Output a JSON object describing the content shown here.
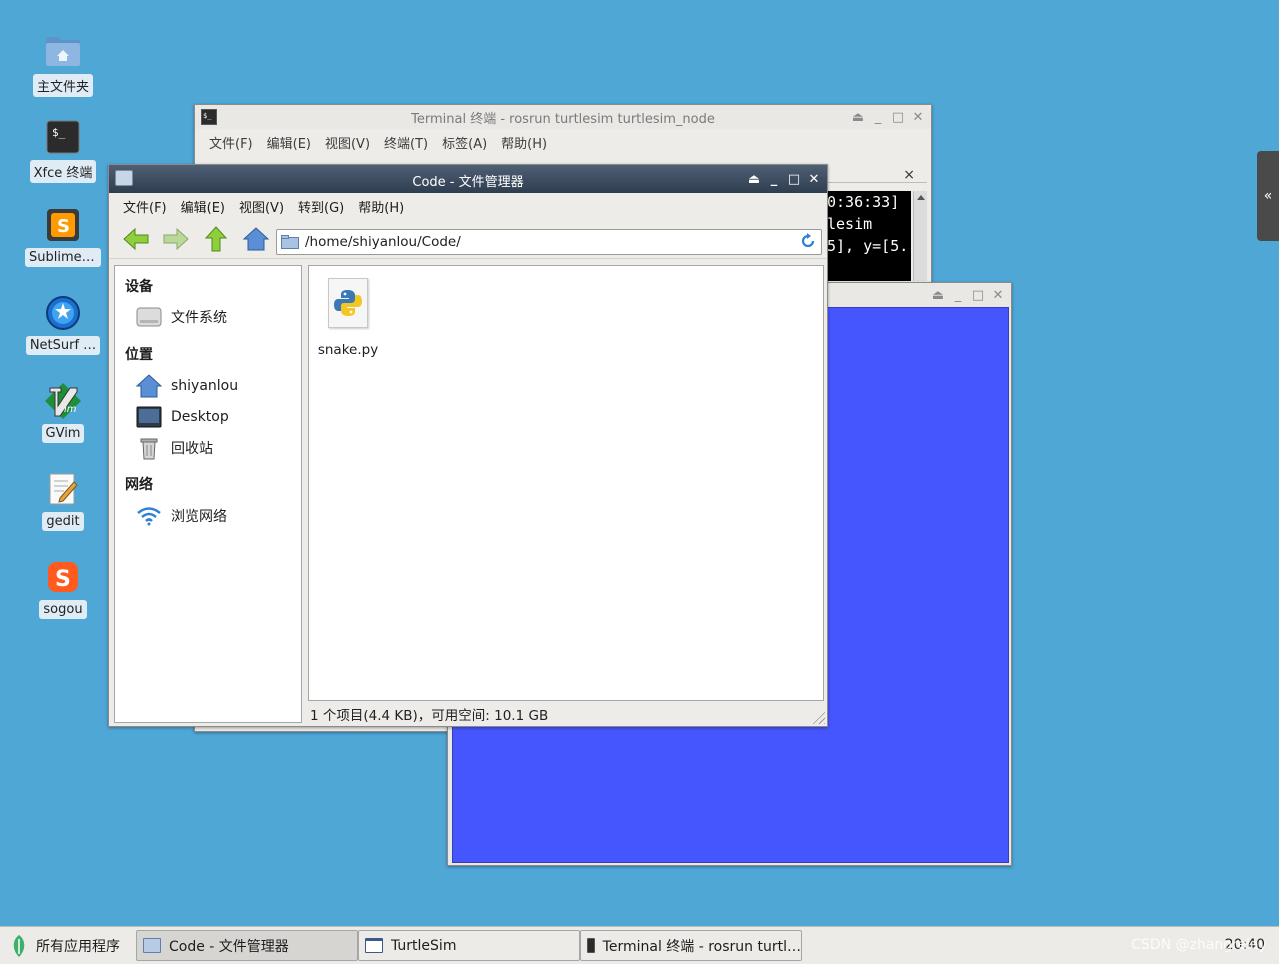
{
  "desktop": {
    "icons": [
      {
        "label": "主文件夹",
        "icon": "home-folder-icon"
      },
      {
        "label": "Xfce 终端",
        "icon": "terminal-icon"
      },
      {
        "label": "Sublime …",
        "icon": "sublime-icon"
      },
      {
        "label": "NetSurf …",
        "icon": "netsurf-icon"
      },
      {
        "label": "GVim",
        "icon": "gvim-icon"
      },
      {
        "label": "gedit",
        "icon": "gedit-icon"
      },
      {
        "label": "sogou",
        "icon": "sogou-icon"
      }
    ],
    "side_tab": "«"
  },
  "terminal": {
    "title": "Terminal 终端 - rosrun turtlesim turtlesim_node",
    "menu": [
      "文件(F)",
      "编辑(E)",
      "视图(V)",
      "终端(T)",
      "标签(A)",
      "帮助(H)"
    ],
    "tab_close": "×",
    "lines": [
      "0:36:33]",
      "lesim",
      "5], y=[5."
    ]
  },
  "turtlesim": {
    "title": "TurtleSim",
    "canvas_color": "#4556ff"
  },
  "file_manager": {
    "title": "Code - 文件管理器",
    "menu": [
      "文件(F)",
      "编辑(E)",
      "视图(V)",
      "转到(G)",
      "帮助(H)"
    ],
    "path": "/home/shiyanlou/Code/",
    "sidebar": {
      "devices_heading": "设备",
      "devices": [
        {
          "label": "文件系统",
          "icon": "drive-icon"
        }
      ],
      "places_heading": "位置",
      "places": [
        {
          "label": "shiyanlou",
          "icon": "home-icon"
        },
        {
          "label": "Desktop",
          "icon": "desktop-icon"
        },
        {
          "label": "回收站",
          "icon": "trash-icon"
        }
      ],
      "network_heading": "网络",
      "network": [
        {
          "label": "浏览网络",
          "icon": "network-icon"
        }
      ]
    },
    "files": [
      {
        "name": "snake.py",
        "icon": "python-file-icon"
      }
    ],
    "status": "1 个项目(4.4 KB)，可用空间: 10.1 GB"
  },
  "window_buttons": {
    "eject": "⏏",
    "minimize": "_",
    "maximize": "□",
    "close": "✕"
  },
  "taskbar": {
    "menu_label": "所有应用程序",
    "tasks": [
      {
        "label": "Code - 文件管理器",
        "active": true
      },
      {
        "label": "TurtleSim",
        "active": false
      },
      {
        "label": "Terminal 终端 - rosrun turtl…",
        "active": false
      }
    ],
    "clock": "20:40",
    "watermark": "CSDN @zhangrelay"
  }
}
